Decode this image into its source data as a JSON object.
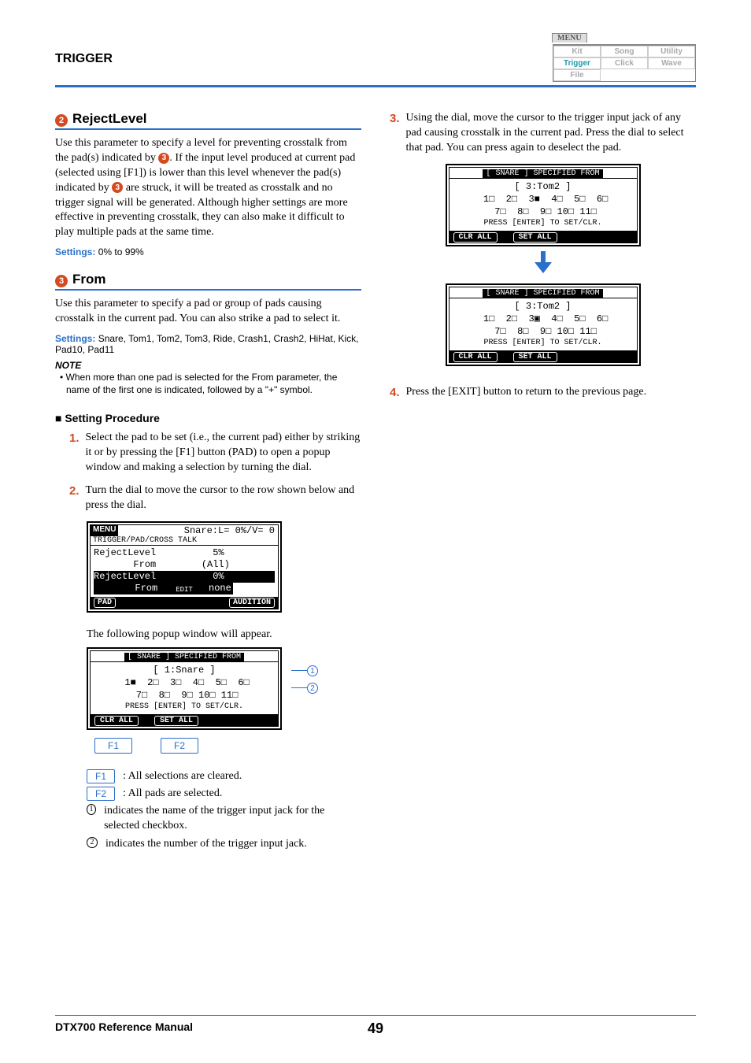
{
  "header": {
    "title": "TRIGGER"
  },
  "menu": {
    "tab": "MENU",
    "row1": [
      "Kit",
      "Song",
      "Utility"
    ],
    "row2": [
      "Trigger",
      "Click",
      "Wave"
    ],
    "row3": [
      "File"
    ]
  },
  "sec2": {
    "num": "2",
    "title": "RejectLevel",
    "body_a": "Use this parameter to specify a level for preventing crosstalk from the pad(s) indicated by ",
    "body_b": ". If the input level produced at current pad (selected using [F1]) is lower than this level whenever the pad(s) indicated by ",
    "body_c": " are struck, it will be treated as crosstalk and no trigger signal will be generated. Although higher settings are more effective in preventing crosstalk, they can also make it difficult to play multiple pads at the same time.",
    "circ_ref": "3",
    "settings_label": "Settings:",
    "settings_value": "0% to 99%"
  },
  "sec3": {
    "num": "3",
    "title": "From",
    "body": "Use this parameter to specify a pad or group of pads causing crosstalk in the current pad. You can also strike a pad to select it.",
    "settings_label": "Settings:",
    "settings_value": "Snare, Tom1, Tom2, Tom3, Ride, Crash1, Crash2, HiHat, Kick, Pad10, Pad11",
    "note_head": "NOTE",
    "note_body": "• When more than one pad is selected for the From parameter, the name of the first one is indicated, followed by a \"+\" symbol."
  },
  "proc": {
    "head": "■ Setting Procedure",
    "s1": {
      "n": "1.",
      "t": "Select the pad to be set (i.e., the current pad) either by striking it or by pressing the [F1] button (PAD) to open a popup window and making a selection by turning the dial."
    },
    "s2": {
      "n": "2.",
      "t": "Turn the dial to move the cursor to the row shown below and press the dial."
    }
  },
  "screen1": {
    "menu": "MENU",
    "status": "Snare:L=  0%/V=  0",
    "bc": "TRIGGER/PAD/CROSS TALK",
    "l1": "RejectLevel          5%",
    "l2": "       From        (All)",
    "l3": "RejectLevel          0%",
    "l4": "       From         none",
    "edit": "EDIT",
    "b1": "PAD",
    "b2": "AUDITION"
  },
  "popup_caption": "The following popup window will appear.",
  "popup1": {
    "bar": "[ SNARE ] SPECIFIED FROM",
    "name": "[  1:Snare  ]",
    "row1": " 1■  2□  3□  4□  5□  6□",
    "row2": " 7□  8□  9□ 10□ 11□",
    "msg": "PRESS [ENTER] TO SET/CLR.",
    "b1": "CLR ALL",
    "b2": "SET ALL"
  },
  "annots": {
    "a1": "1",
    "a2": "2"
  },
  "fbtns": {
    "f1": "F1",
    "f2": "F2"
  },
  "fkey1": {
    "k": "F1",
    "t": ": All selections are cleared."
  },
  "fkey2": {
    "k": "F2",
    "t": ": All pads are selected."
  },
  "ind1": {
    "n": "1",
    "t": "indicates the name of the trigger input jack for the selected checkbox."
  },
  "ind2": {
    "n": "2",
    "t": "indicates the number of the trigger input jack."
  },
  "s3": {
    "n": "3.",
    "t": "Using the dial, move the cursor to the trigger input jack of any pad causing crosstalk in the current pad. Press the dial to select that pad. You can press again to deselect the pad."
  },
  "popup2a": {
    "bar": "[ SNARE ] SPECIFIED FROM",
    "name": "[  3:Tom2   ]",
    "row1": " 1□  2□  3■  4□  5□  6□",
    "row2": " 7□  8□  9□ 10□ 11□",
    "msg": "PRESS [ENTER] TO SET/CLR.",
    "b1": "CLR ALL",
    "b2": "SET ALL"
  },
  "popup2b": {
    "bar": "[ SNARE ] SPECIFIED FROM",
    "name": "[  3:Tom2   ]",
    "row1": " 1□  2□  3▣  4□  5□  6□",
    "row2": " 7□  8□  9□ 10□ 11□",
    "msg": "PRESS [ENTER] TO SET/CLR.",
    "b1": "CLR ALL",
    "b2": "SET ALL"
  },
  "s4": {
    "n": "4.",
    "t": "Press the [EXIT] button to return to the previous page."
  },
  "footer": {
    "left": "DTX700  Reference Manual",
    "page": "49"
  }
}
